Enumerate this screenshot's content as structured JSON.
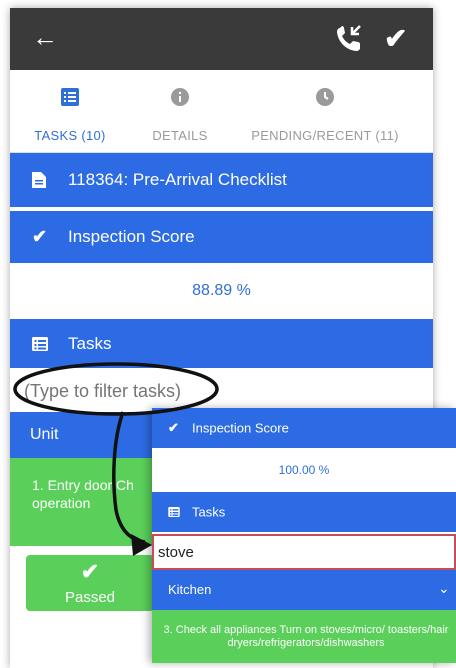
{
  "topbar": {
    "back_icon": "arrow-left-icon",
    "call_icon": "phone-callback-icon",
    "save_icon": "checkmark-icon"
  },
  "tabs": [
    {
      "label": "TASKS (10)",
      "icon": "list-icon",
      "active": true
    },
    {
      "label": "DETAILS",
      "icon": "info-icon",
      "active": false
    },
    {
      "label": "PENDING/RECENT (11)",
      "icon": "clock-icon",
      "active": false
    }
  ],
  "checklist": {
    "title": "118364: Pre-Arrival Checklist",
    "icon": "document-icon"
  },
  "inspection": {
    "label": "Inspection Score",
    "score": "88.89 %"
  },
  "tasks_header": {
    "label": "Tasks"
  },
  "filter": {
    "placeholder": "(Type to filter tasks)"
  },
  "unit_row": {
    "label": "Unit"
  },
  "task_item": {
    "text": "1. Entry door Ch operation"
  },
  "passed_button": {
    "label": "Passed"
  },
  "inset": {
    "inspection_label": "Inspection Score",
    "score": "100.00 %",
    "tasks_label": "Tasks",
    "search_value": "stove",
    "group_label": "Kitchen",
    "task_text": "3. Check all appliances Turn on stoves/micro/ toasters/hair dryers/refrigerators/dishwashers"
  },
  "colors": {
    "primary": "#2c6be3",
    "success": "#5ad05a",
    "topbar": "#3a3a3a",
    "highlight": "#c94a5a"
  }
}
